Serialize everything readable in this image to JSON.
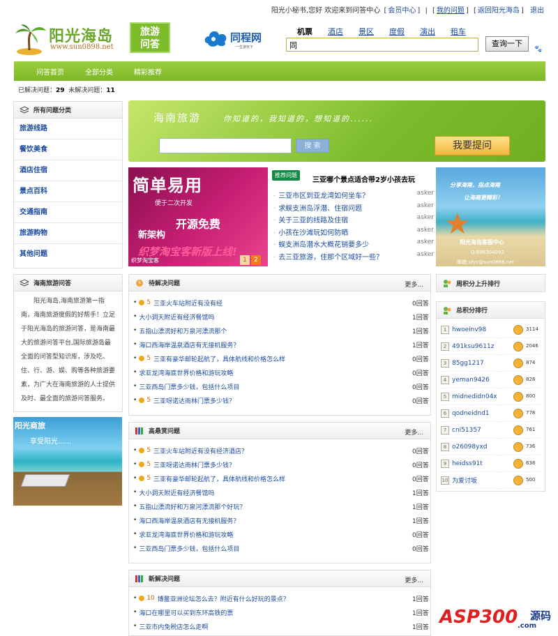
{
  "topbar": {
    "greeting": "阳光小秘书,您好 欢迎来到问答中心",
    "member_center": "会员中心",
    "my_questions": "我的问题",
    "back_home": "返回阳光海岛",
    "logout": "退出"
  },
  "logo": {
    "name": "阳光海岛",
    "url": "www.sun0898.net",
    "badge_line1": "旅游",
    "badge_line2": "问答"
  },
  "partner": {
    "name": "同程网",
    "sub": "一生游天下"
  },
  "search": {
    "tabs": [
      "机票",
      "酒店",
      "景区",
      "度假",
      "演出",
      "租车"
    ],
    "value": "同",
    "button": "查询一下"
  },
  "nav": [
    "问答首页",
    "全部分类",
    "精彩推荐"
  ],
  "stats": {
    "solved_label": "已解决问题：",
    "solved": "29",
    "unsolved_label": "未解决问题：",
    "unsolved": "11"
  },
  "categories": {
    "title": "所有问题分类",
    "items": [
      "旅游线路",
      "餐饮美食",
      "酒店住宿",
      "景点百科",
      "交通指南",
      "旅游购物",
      "其他问题"
    ]
  },
  "about": {
    "title": "海南旅游问答",
    "text": "阳光海岛,海南旅游第一指南，海南旅游度假的好帮手！立足于阳光海岛的旅游问答，是海南最大的旅游问答平台,国际旅游岛最全面的问答型知识库，涉及吃、住、行、游、娱、购等各种旅游要素，为广大在海南旅游的人士提供及时、最全面的旅游问答服务。"
  },
  "side_promo": {
    "title": "阳光商旅",
    "slogan": "享受阳光......"
  },
  "banner": {
    "title": "海南旅游",
    "slogan": "你知道的，我知道的，想知道的......",
    "search_button": "搜 索",
    "ask_button": "我要提问"
  },
  "promo": {
    "line1": "简单易用",
    "line2": "便于二次开发",
    "line3": "开源免费",
    "line4": "新架构",
    "line5": "织梦淘宝客新版上线!",
    "caption": "织梦淘宝客",
    "page1": "1",
    "page2": "2"
  },
  "recommend": {
    "tag": "推荐问题",
    "title": "三亚哪个景点适合带2岁小孩去玩",
    "items": [
      {
        "q": "三亚市区到亚龙湾如何坐车？",
        "who": "asker"
      },
      {
        "q": "求蜈支洲岛浮潜、住宿问题",
        "who": "asker"
      },
      {
        "q": "关于三亚的线路及住宿",
        "who": "asker"
      },
      {
        "q": "小孩在沙滩玩如何防晒",
        "who": "asker"
      },
      {
        "q": "蜈支洲岛潜水大概花销要多少",
        "who": "asker"
      },
      {
        "q": "去三亚旅游，住那个区域好一些？",
        "who": "asker"
      }
    ]
  },
  "beach_promo": {
    "line1": "分享海南，指点海南",
    "line2": "让海南更精彩！",
    "line3": "阳光海岛客服中心",
    "line4": "Q:896304092",
    "line5": "邮箱:ufyc@sun0898.net"
  },
  "pending": {
    "title": "待解决问题",
    "more": "更多...",
    "items": [
      {
        "pts": "5",
        "q": "三亚火车站附近有没有经",
        "ans": "0回答"
      },
      {
        "pts": "",
        "q": "大小洞天附近有经济餐馆吗",
        "ans": "1回答"
      },
      {
        "pts": "",
        "q": "五指山漂流好和万泉河漂流那个",
        "ans": "1回答"
      },
      {
        "pts": "",
        "q": "海口西海岸温泉酒店有无接机服务？",
        "ans": "1回答"
      },
      {
        "pts": "5",
        "q": "三亚有豪华邮轮起航了，具体航线和价格怎么样",
        "ans": "0回答"
      },
      {
        "pts": "",
        "q": "求亚龙湾海底世界价格和游玩攻略",
        "ans": "0回答"
      },
      {
        "pts": "",
        "q": "三亚西岛门票多少钱，包括什么项目",
        "ans": "0回答"
      },
      {
        "pts": "5",
        "q": "三亚呀诺达雨林门票多少钱？",
        "ans": "0回答"
      }
    ]
  },
  "high": {
    "title": "高悬赏问题",
    "more": "更多...",
    "items": [
      {
        "pts": "5",
        "q": "三亚火车站附近有没有经济酒店？",
        "ans": "0回答"
      },
      {
        "pts": "5",
        "q": "三亚呀诺达雨林门票多少钱？",
        "ans": "0回答"
      },
      {
        "pts": "5",
        "q": "三亚有豪华邮轮起航了，具体航线和价格怎么样",
        "ans": "0回答"
      },
      {
        "pts": "",
        "q": "大小洞天附近有经济餐馆吗",
        "ans": "1回答"
      },
      {
        "pts": "",
        "q": "五指山漂流好和万泉河漂流那个好玩？",
        "ans": "1回答"
      },
      {
        "pts": "",
        "q": "海口西海岸温泉酒店有无接机服务？",
        "ans": "1回答"
      },
      {
        "pts": "",
        "q": "求亚龙湾海底世界价格和游玩攻略",
        "ans": "0回答"
      },
      {
        "pts": "",
        "q": "三亚西岛门票多少钱，包括什么项目",
        "ans": "0回答"
      }
    ]
  },
  "newly": {
    "title": "新解决问题",
    "more": "更多...",
    "items": [
      {
        "pts": "10",
        "q": "博鳌亚洲论坛怎么去？附近有什么好玩的景点？",
        "ans": "1回答"
      },
      {
        "pts": "",
        "q": "海口在哪里可以买到东环高铁的票",
        "ans": "1回答"
      },
      {
        "pts": "",
        "q": "三亚市内免税店怎么走啊",
        "ans": "1回答"
      }
    ]
  },
  "weekly": {
    "title": "周积分上升排行"
  },
  "total": {
    "title": "总积分排行",
    "items": [
      {
        "n": "1",
        "user": "hwoeinv98",
        "score": "3114"
      },
      {
        "n": "2",
        "user": "491ksu9611z",
        "score": "2046"
      },
      {
        "n": "3",
        "user": "85gg1217",
        "score": "874"
      },
      {
        "n": "4",
        "user": "yeman9426",
        "score": "828"
      },
      {
        "n": "5",
        "user": "midnedidn04x",
        "score": "800"
      },
      {
        "n": "6",
        "user": "qodneidnd1",
        "score": "778"
      },
      {
        "n": "7",
        "user": "cni51357",
        "score": "761"
      },
      {
        "n": "8",
        "user": "o26098yxd",
        "score": "736"
      },
      {
        "n": "9",
        "user": "heidss91t",
        "score": "638"
      },
      {
        "n": "10",
        "user": "为爱讨坂",
        "score": "500"
      }
    ]
  },
  "watermark": {
    "brand": "ASP300",
    "word": "源码",
    "domain": ".com"
  }
}
